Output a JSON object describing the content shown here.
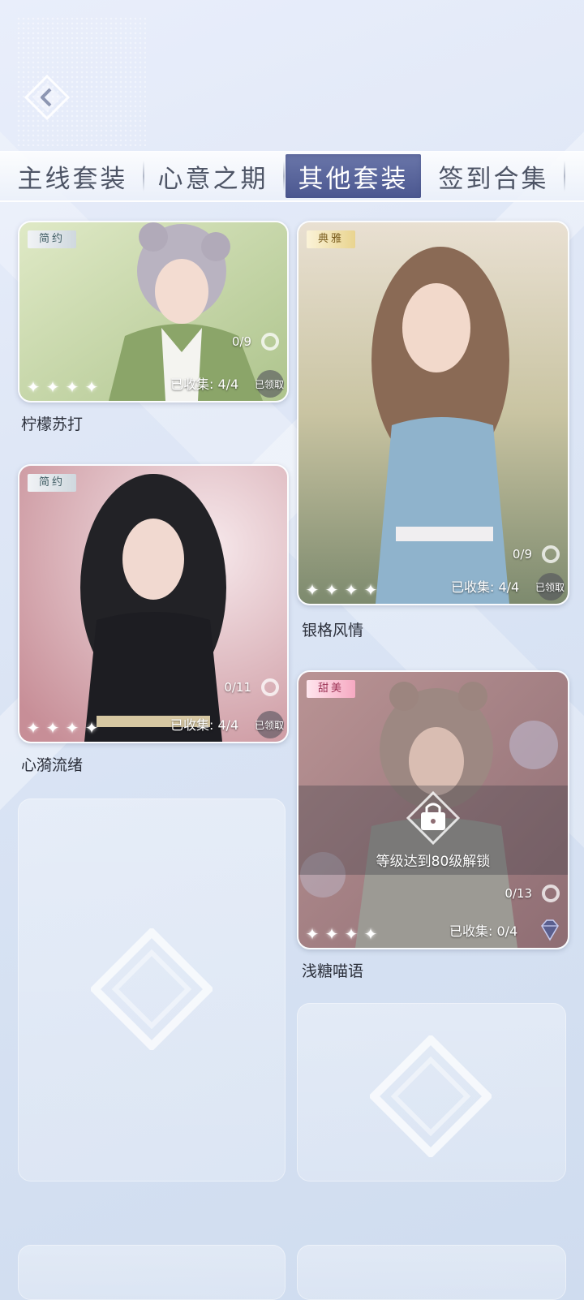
{
  "tabs": [
    {
      "label": "主线套装",
      "active": false
    },
    {
      "label": "心意之期",
      "active": false
    },
    {
      "label": "其他套装",
      "active": true
    },
    {
      "label": "签到合集",
      "active": false
    }
  ],
  "cards": [
    {
      "tag": "简约",
      "name": "柠檬苏打",
      "progress": "0/9",
      "collected": "已收集: 4/4",
      "claimed": "已领取",
      "stars": 4
    },
    {
      "tag": "典雅",
      "name": "银格风情",
      "progress": "0/9",
      "collected": "已收集: 4/4",
      "claimed": "已领取",
      "stars": 4
    },
    {
      "tag": "简约",
      "name": "心漪流绪",
      "progress": "0/11",
      "collected": "已收集: 4/4",
      "claimed": "已领取",
      "stars": 4
    },
    {
      "tag": "甜美",
      "name": "浅糖喵语",
      "progress": "0/13",
      "collected": "已收集: 0/4",
      "locked_text": "等级达到80级解锁",
      "stars": 4
    }
  ],
  "icons": {
    "back": "back-arrow-icon",
    "star": "sparkle-star-icon",
    "lock": "lock-icon",
    "ring": "ring-icon",
    "gem": "diamond-icon"
  },
  "colors": {
    "active_tab": "#5a6599",
    "tag_simple": "#cfd8de",
    "tag_elegant": "#e9d48f",
    "tag_sweet": "#f6a9c2"
  }
}
